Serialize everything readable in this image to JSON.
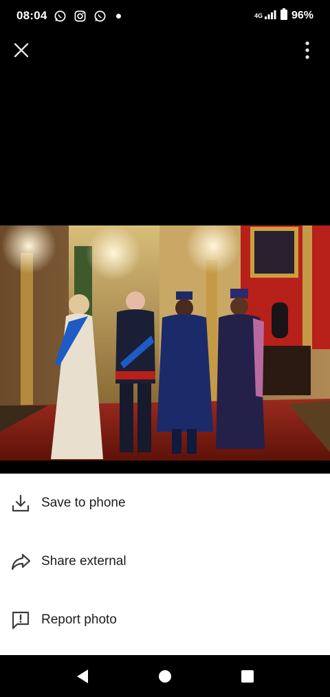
{
  "status_bar": {
    "time": "08:04",
    "battery": "96%",
    "network": "4G",
    "notification_icons": [
      "whatsapp-icon",
      "instagram-icon",
      "whatsapp-icon"
    ]
  },
  "viewer": {
    "close_icon": "close-icon",
    "menu_icon": "more-vert-icon"
  },
  "sheet": {
    "items": [
      {
        "label": "Save to phone",
        "icon": "download-icon"
      },
      {
        "label": "Share external",
        "icon": "share-arrow-icon"
      },
      {
        "label": "Report photo",
        "icon": "report-icon"
      }
    ]
  },
  "nav": {
    "buttons": [
      "back-icon",
      "home-icon",
      "recents-icon"
    ]
  },
  "colors": {
    "background": "#000000",
    "sheet": "#ffffff",
    "text": "#1c1c1c"
  }
}
